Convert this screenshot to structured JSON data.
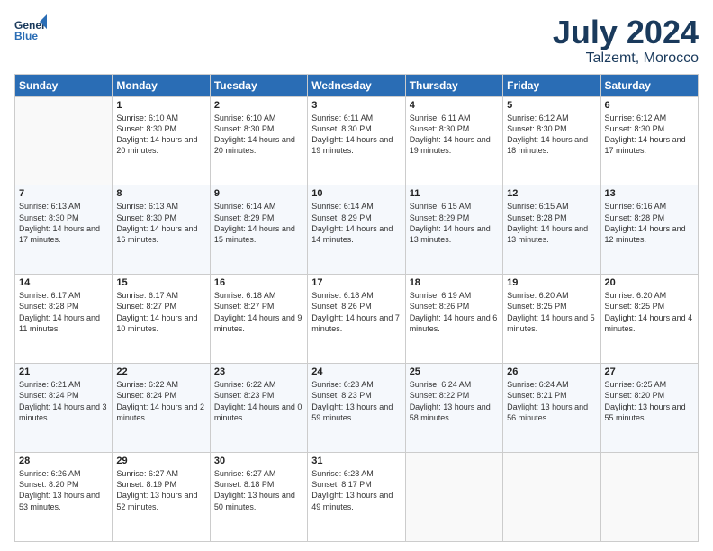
{
  "logo": {
    "line1": "General",
    "line2": "Blue"
  },
  "title": "July 2024",
  "subtitle": "Talzemt, Morocco",
  "days_of_week": [
    "Sunday",
    "Monday",
    "Tuesday",
    "Wednesday",
    "Thursday",
    "Friday",
    "Saturday"
  ],
  "weeks": [
    [
      {
        "day": "",
        "sunrise": "",
        "sunset": "",
        "daylight": ""
      },
      {
        "day": "1",
        "sunrise": "6:10 AM",
        "sunset": "8:30 PM",
        "daylight": "14 hours and 20 minutes."
      },
      {
        "day": "2",
        "sunrise": "6:10 AM",
        "sunset": "8:30 PM",
        "daylight": "14 hours and 20 minutes."
      },
      {
        "day": "3",
        "sunrise": "6:11 AM",
        "sunset": "8:30 PM",
        "daylight": "14 hours and 19 minutes."
      },
      {
        "day": "4",
        "sunrise": "6:11 AM",
        "sunset": "8:30 PM",
        "daylight": "14 hours and 19 minutes."
      },
      {
        "day": "5",
        "sunrise": "6:12 AM",
        "sunset": "8:30 PM",
        "daylight": "14 hours and 18 minutes."
      },
      {
        "day": "6",
        "sunrise": "6:12 AM",
        "sunset": "8:30 PM",
        "daylight": "14 hours and 17 minutes."
      }
    ],
    [
      {
        "day": "7",
        "sunrise": "6:13 AM",
        "sunset": "8:30 PM",
        "daylight": "14 hours and 17 minutes."
      },
      {
        "day": "8",
        "sunrise": "6:13 AM",
        "sunset": "8:30 PM",
        "daylight": "14 hours and 16 minutes."
      },
      {
        "day": "9",
        "sunrise": "6:14 AM",
        "sunset": "8:29 PM",
        "daylight": "14 hours and 15 minutes."
      },
      {
        "day": "10",
        "sunrise": "6:14 AM",
        "sunset": "8:29 PM",
        "daylight": "14 hours and 14 minutes."
      },
      {
        "day": "11",
        "sunrise": "6:15 AM",
        "sunset": "8:29 PM",
        "daylight": "14 hours and 13 minutes."
      },
      {
        "day": "12",
        "sunrise": "6:15 AM",
        "sunset": "8:28 PM",
        "daylight": "14 hours and 13 minutes."
      },
      {
        "day": "13",
        "sunrise": "6:16 AM",
        "sunset": "8:28 PM",
        "daylight": "14 hours and 12 minutes."
      }
    ],
    [
      {
        "day": "14",
        "sunrise": "6:17 AM",
        "sunset": "8:28 PM",
        "daylight": "14 hours and 11 minutes."
      },
      {
        "day": "15",
        "sunrise": "6:17 AM",
        "sunset": "8:27 PM",
        "daylight": "14 hours and 10 minutes."
      },
      {
        "day": "16",
        "sunrise": "6:18 AM",
        "sunset": "8:27 PM",
        "daylight": "14 hours and 9 minutes."
      },
      {
        "day": "17",
        "sunrise": "6:18 AM",
        "sunset": "8:26 PM",
        "daylight": "14 hours and 7 minutes."
      },
      {
        "day": "18",
        "sunrise": "6:19 AM",
        "sunset": "8:26 PM",
        "daylight": "14 hours and 6 minutes."
      },
      {
        "day": "19",
        "sunrise": "6:20 AM",
        "sunset": "8:25 PM",
        "daylight": "14 hours and 5 minutes."
      },
      {
        "day": "20",
        "sunrise": "6:20 AM",
        "sunset": "8:25 PM",
        "daylight": "14 hours and 4 minutes."
      }
    ],
    [
      {
        "day": "21",
        "sunrise": "6:21 AM",
        "sunset": "8:24 PM",
        "daylight": "14 hours and 3 minutes."
      },
      {
        "day": "22",
        "sunrise": "6:22 AM",
        "sunset": "8:24 PM",
        "daylight": "14 hours and 2 minutes."
      },
      {
        "day": "23",
        "sunrise": "6:22 AM",
        "sunset": "8:23 PM",
        "daylight": "14 hours and 0 minutes."
      },
      {
        "day": "24",
        "sunrise": "6:23 AM",
        "sunset": "8:23 PM",
        "daylight": "13 hours and 59 minutes."
      },
      {
        "day": "25",
        "sunrise": "6:24 AM",
        "sunset": "8:22 PM",
        "daylight": "13 hours and 58 minutes."
      },
      {
        "day": "26",
        "sunrise": "6:24 AM",
        "sunset": "8:21 PM",
        "daylight": "13 hours and 56 minutes."
      },
      {
        "day": "27",
        "sunrise": "6:25 AM",
        "sunset": "8:20 PM",
        "daylight": "13 hours and 55 minutes."
      }
    ],
    [
      {
        "day": "28",
        "sunrise": "6:26 AM",
        "sunset": "8:20 PM",
        "daylight": "13 hours and 53 minutes."
      },
      {
        "day": "29",
        "sunrise": "6:27 AM",
        "sunset": "8:19 PM",
        "daylight": "13 hours and 52 minutes."
      },
      {
        "day": "30",
        "sunrise": "6:27 AM",
        "sunset": "8:18 PM",
        "daylight": "13 hours and 50 minutes."
      },
      {
        "day": "31",
        "sunrise": "6:28 AM",
        "sunset": "8:17 PM",
        "daylight": "13 hours and 49 minutes."
      },
      {
        "day": "",
        "sunrise": "",
        "sunset": "",
        "daylight": ""
      },
      {
        "day": "",
        "sunrise": "",
        "sunset": "",
        "daylight": ""
      },
      {
        "day": "",
        "sunrise": "",
        "sunset": "",
        "daylight": ""
      }
    ]
  ]
}
